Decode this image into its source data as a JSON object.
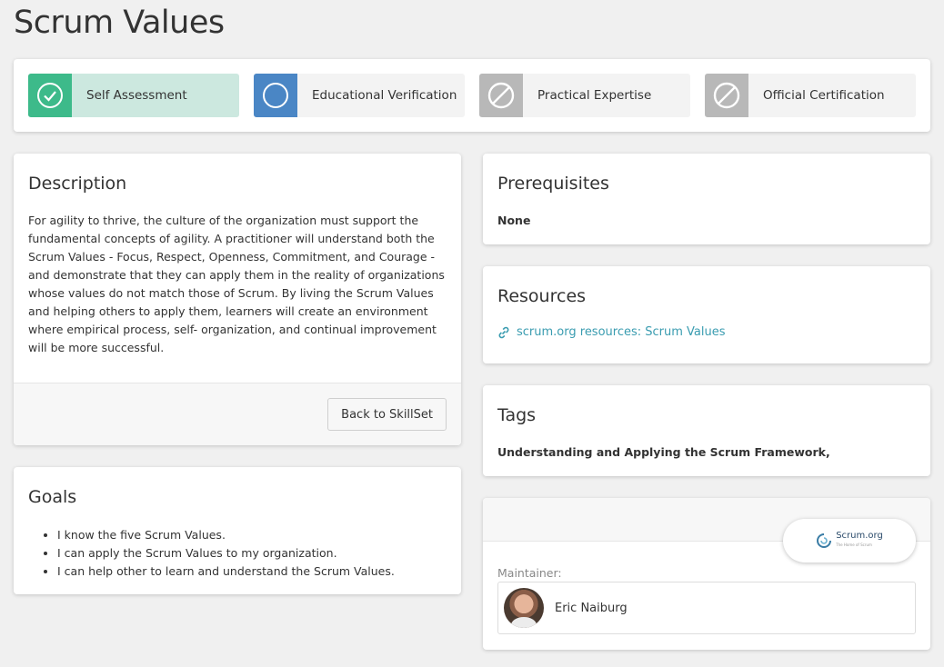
{
  "page": {
    "title": "Scrum Values"
  },
  "stages": [
    {
      "label": "Self Assessment",
      "icon": "check-circle-icon",
      "icon_bg": "#3dba8a",
      "bg": "#cce8df"
    },
    {
      "label": "Educational Verification",
      "icon": "circle-icon",
      "icon_bg": "#4a86c5",
      "bg": "#f3f3f3"
    },
    {
      "label": "Practical Expertise",
      "icon": "ban-icon",
      "icon_bg": "#b8b8b8",
      "bg": "#f3f3f3"
    },
    {
      "label": "Official Certification",
      "icon": "ban-icon",
      "icon_bg": "#b8b8b8",
      "bg": "#f3f3f3"
    }
  ],
  "description": {
    "heading": "Description",
    "text": "For agility to thrive, the culture of the organization must support the fundamental concepts of agility. A practitioner will understand both the Scrum Values - Focus, Respect, Openness, Commitment, and Courage - and demonstrate that they can apply them in the reality of organizations whose values do not match those of Scrum. By living the Scrum Values and helping others to apply them, learners will create an environment where empirical process, self- organization, and continual improvement will be more successful.",
    "back_label": "Back to SkillSet"
  },
  "goals": {
    "heading": "Goals",
    "items": [
      "I know the five Scrum Values.",
      "I can apply the Scrum Values to my organization.",
      "I can help other to learn and understand the Scrum Values."
    ]
  },
  "prerequisites": {
    "heading": "Prerequisites",
    "value": "None"
  },
  "resources": {
    "heading": "Resources",
    "link_label": "scrum.org resources: Scrum Values",
    "link_color": "#3a9cb0"
  },
  "tags": {
    "heading": "Tags",
    "value": "Understanding and Applying the Scrum Framework,"
  },
  "maintainer": {
    "logo_text": "Scrum.org",
    "logo_sub": "The Home of Scrum",
    "label": "Maintainer:",
    "name": "Eric Naiburg"
  }
}
